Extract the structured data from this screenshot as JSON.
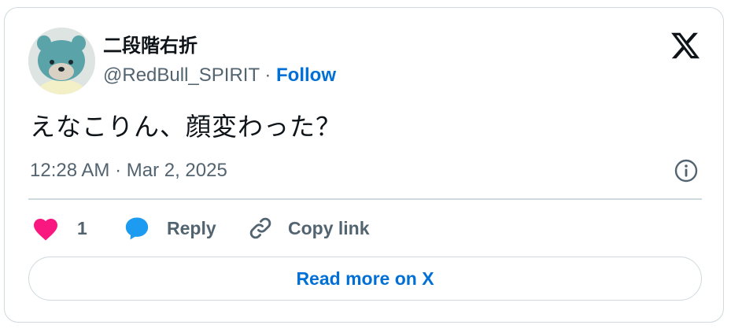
{
  "author": {
    "display_name": "二段階右折",
    "handle": "@RedBull_SPIRIT",
    "separator": "·",
    "follow_label": "Follow"
  },
  "brand": {
    "logo_icon": "x-logo-icon"
  },
  "tweet": {
    "text": "えなこりん、顔変わった？",
    "timestamp": "12:28 AM · Mar 2, 2025"
  },
  "actions": {
    "like_count": "1",
    "reply_label": "Reply",
    "copy_link_label": "Copy link"
  },
  "footer": {
    "read_more_label": "Read more on X"
  },
  "colors": {
    "like": "#f91880",
    "reply": "#1d9bf0",
    "link": "#006fd6",
    "muted": "#536471",
    "border": "#cfd9de"
  }
}
